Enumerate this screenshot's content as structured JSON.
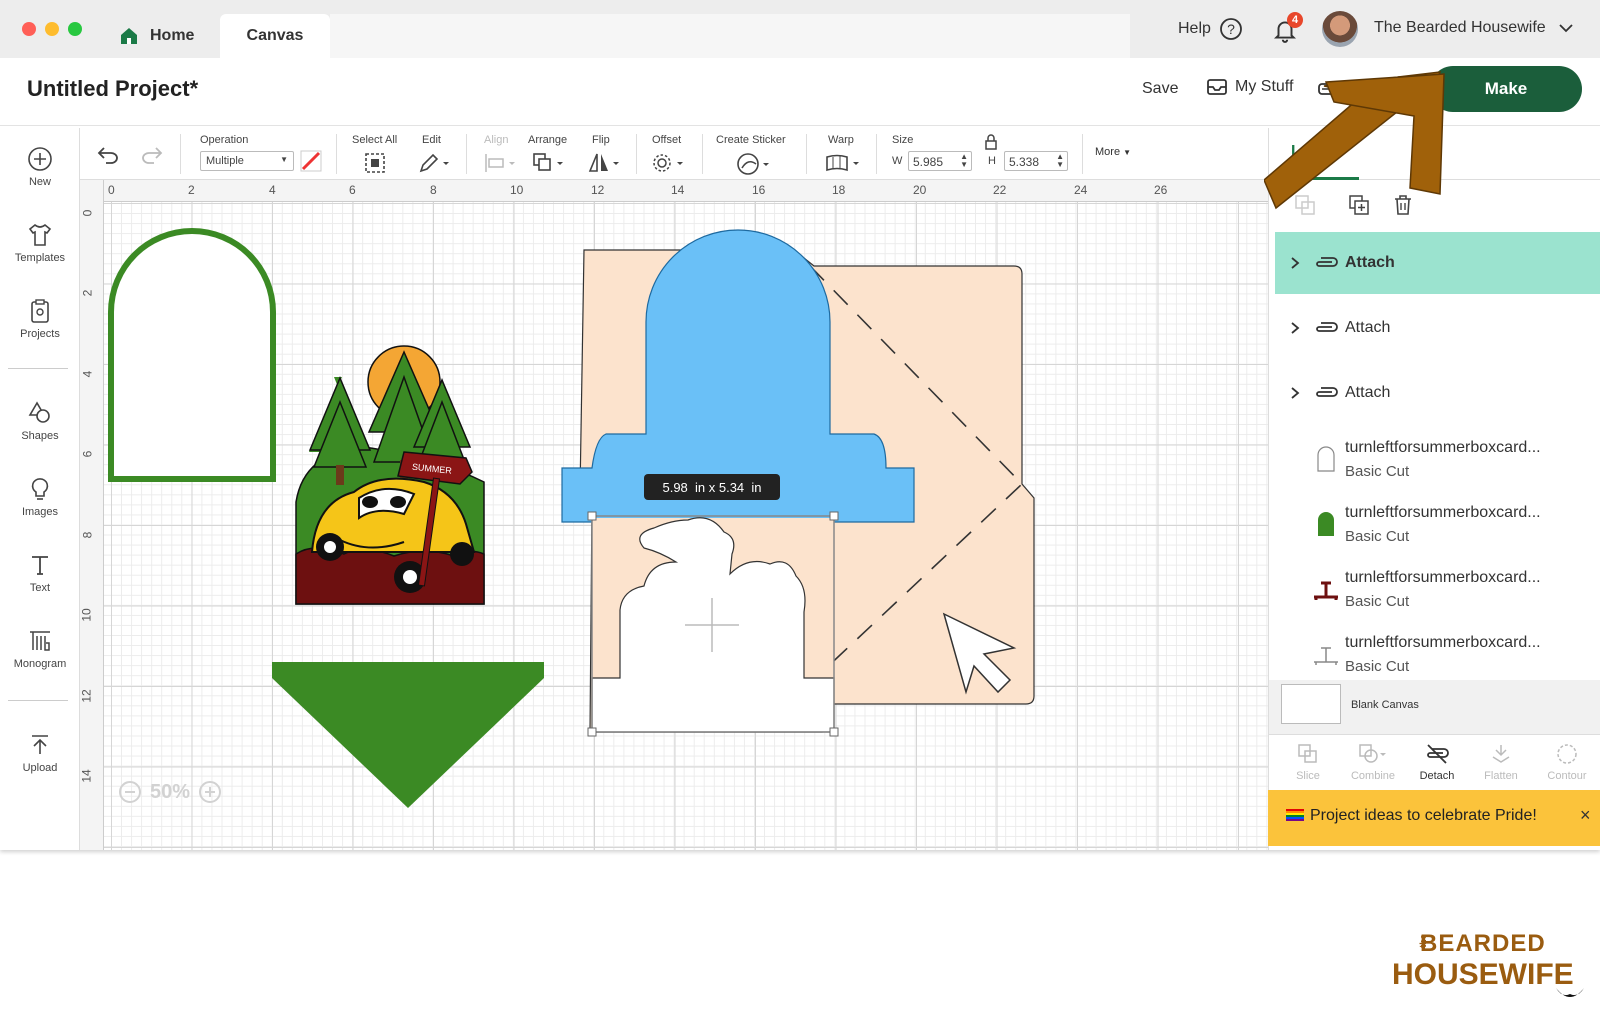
{
  "tabs": {
    "home": "Home",
    "canvas": "Canvas"
  },
  "topbar": {
    "help": "Help",
    "notification_count": "4",
    "user_name": "The Bearded Housewife"
  },
  "header": {
    "project_title": "Untitled Project*",
    "save": "Save",
    "my_stuff": "My Stuff",
    "make": "Make"
  },
  "toolbar": {
    "operation_label": "Operation",
    "operation_value": "Multiple",
    "select_all": "Select All",
    "edit": "Edit",
    "align": "Align",
    "arrange": "Arrange",
    "flip": "Flip",
    "offset": "Offset",
    "create_sticker": "Create Sticker",
    "warp": "Warp",
    "size": "Size",
    "w_label": "W",
    "w_value": "5.985",
    "h_label": "H",
    "h_value": "5.338",
    "more": "More"
  },
  "leftbar": [
    "New",
    "Templates",
    "Projects",
    "Shapes",
    "Images",
    "Text",
    "Monogram",
    "Upload"
  ],
  "ruler": {
    "top": [
      "0",
      "2",
      "4",
      "6",
      "8",
      "10",
      "12",
      "14",
      "16",
      "18",
      "20",
      "22",
      "24",
      "26"
    ],
    "left": [
      "0",
      "2",
      "4",
      "6",
      "8",
      "10",
      "12",
      "14"
    ]
  },
  "canvas": {
    "selection_dims": "5.98  in x 5.34  in",
    "zoom": "50%",
    "sign_text": "SUMMER"
  },
  "panel": {
    "tab_layers": "Layers",
    "layers": [
      {
        "title": "Attach",
        "sub": ""
      },
      {
        "title": "Attach",
        "sub": ""
      },
      {
        "title": "Attach",
        "sub": ""
      },
      {
        "title": "turnleftforsummerboxcard...",
        "sub": "Basic Cut"
      },
      {
        "title": "turnleftforsummerboxcard...",
        "sub": "Basic Cut"
      },
      {
        "title": "turnleftforsummerboxcard...",
        "sub": "Basic Cut"
      },
      {
        "title": "turnleftforsummerboxcard...",
        "sub": "Basic Cut"
      }
    ],
    "blank_canvas": "Blank Canvas",
    "actions": [
      "Slice",
      "Combine",
      "Detach",
      "Flatten",
      "Contour"
    ]
  },
  "banner": {
    "text": "Project ideas to celebrate Pride!"
  },
  "watermark": {
    "line1": "BEARDED",
    "line2": "HOUSEWIFE",
    "prefix": "the"
  },
  "colors": {
    "make_green": "#1b5e3b",
    "attach_highlight": "#9be3cf",
    "arrow_brown": "#a0610a",
    "banner": "#fbc33b",
    "blue": "#6ac0f7",
    "peach": "#fce3cd",
    "green": "#3b8a24"
  }
}
